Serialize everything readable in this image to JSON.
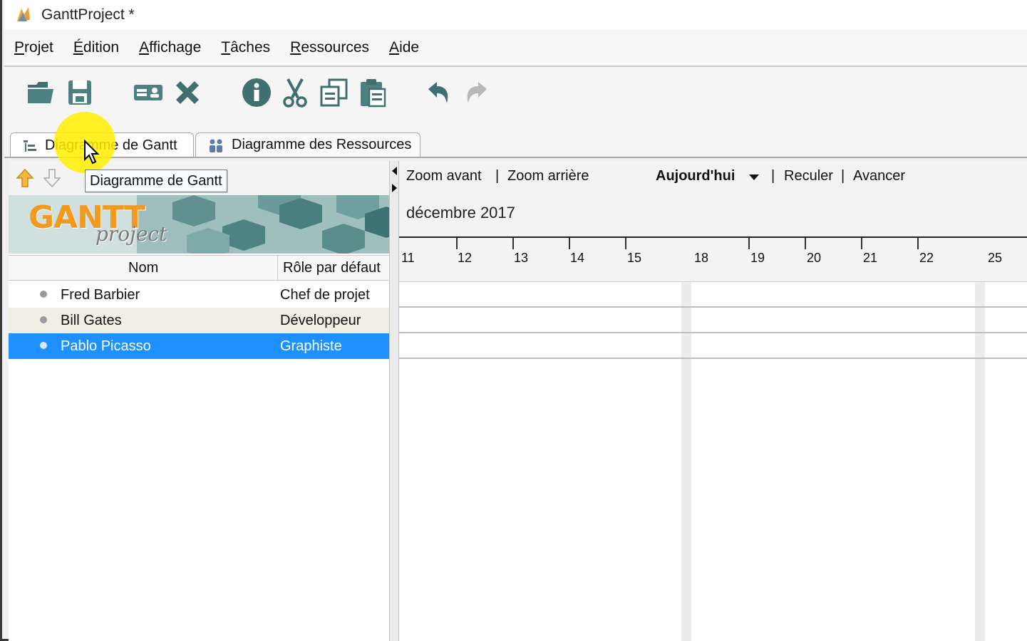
{
  "window": {
    "title": "GanttProject *"
  },
  "menu": [
    {
      "label": "Projet"
    },
    {
      "label": "Édition"
    },
    {
      "label": "Affichage"
    },
    {
      "label": "Tâches"
    },
    {
      "label": "Ressources"
    },
    {
      "label": "Aide"
    }
  ],
  "toolbar": {
    "buttons": [
      "open-icon",
      "save-icon",
      "new-resource-icon",
      "delete-icon",
      "properties-icon",
      "cut-icon",
      "copy-icon",
      "paste-icon",
      "undo-icon",
      "redo-icon"
    ]
  },
  "tabs": [
    {
      "label": "Diagramme de Gantt",
      "active": true
    },
    {
      "label": "Diagramme des Ressources",
      "active": false
    }
  ],
  "tooltip": "Diagramme de Gantt",
  "banner": {
    "logo_main": "GANTT",
    "logo_sub": "project"
  },
  "table": {
    "columns": [
      "Nom",
      "Rôle par défaut"
    ],
    "rows": [
      {
        "name": "Fred Barbier",
        "role": "Chef de projet",
        "state": "normal"
      },
      {
        "name": "Bill Gates",
        "role": "Développeur",
        "state": "alt"
      },
      {
        "name": "Pablo Picasso",
        "role": "Graphiste",
        "state": "selected"
      }
    ]
  },
  "chart_toolbar": {
    "zoom_in": "Zoom avant",
    "zoom_out": "Zoom arrière",
    "today": "Aujourd'hui",
    "back": "Reculer",
    "forward": "Avancer",
    "separator": "|"
  },
  "timeline": {
    "month": "décembre 2017",
    "days": [
      "11",
      "12",
      "13",
      "14",
      "15",
      "18",
      "19",
      "20",
      "21",
      "22",
      "25"
    ]
  },
  "colors": {
    "selection": "#1e90ff",
    "alt_row": "#f1eee4",
    "highlight": "#ffee00",
    "icon_teal": "#3f6f6f"
  }
}
